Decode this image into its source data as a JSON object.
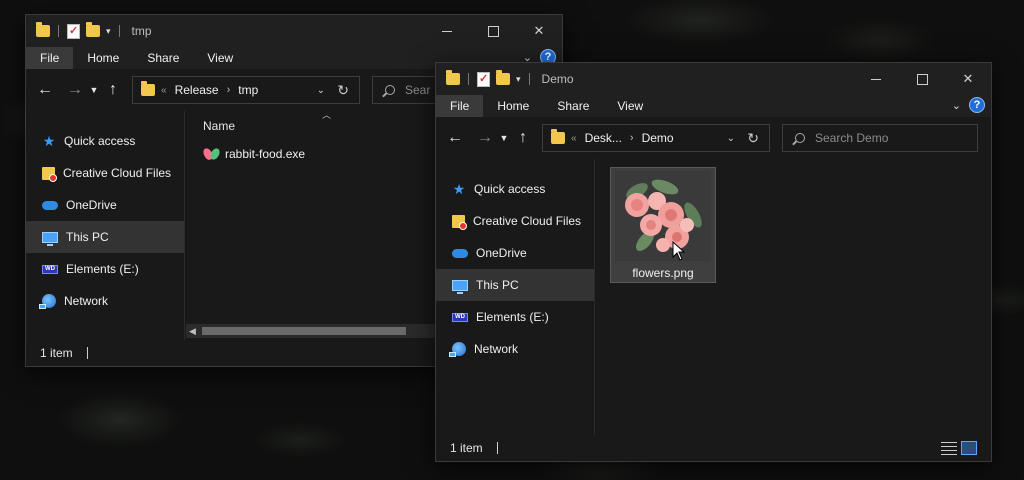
{
  "window_back": {
    "title": "tmp",
    "ribbon_tabs": [
      "File",
      "Home",
      "Share",
      "View"
    ],
    "address": {
      "crumbs": [
        "Release",
        "tmp"
      ]
    },
    "search_placeholder": "Sear",
    "sidebar": [
      "Quick access",
      "Creative Cloud Files",
      "OneDrive",
      "This PC",
      "Elements (E:)",
      "Network"
    ],
    "selected_nav": "This PC",
    "column_header": "Name",
    "files": [
      {
        "name": "rabbit-food.exe",
        "icon": "exe-app-icon"
      }
    ],
    "status": "1 item"
  },
  "window_front": {
    "title": "Demo",
    "ribbon_tabs": [
      "File",
      "Home",
      "Share",
      "View"
    ],
    "address": {
      "crumbs": [
        "Desk...",
        "Demo"
      ]
    },
    "search_placeholder": "Search Demo",
    "sidebar": [
      "Quick access",
      "Creative Cloud Files",
      "OneDrive",
      "This PC",
      "Elements (E:)",
      "Network"
    ],
    "selected_nav": "This PC",
    "files": [
      {
        "name": "flowers.png",
        "icon": "image-thumbnail"
      }
    ],
    "status": "1 item"
  },
  "colors": {
    "accent": "#1e6fd9",
    "folder": "#f1c84b",
    "window_bg": "#191919",
    "titlebar_bg": "#202020"
  }
}
